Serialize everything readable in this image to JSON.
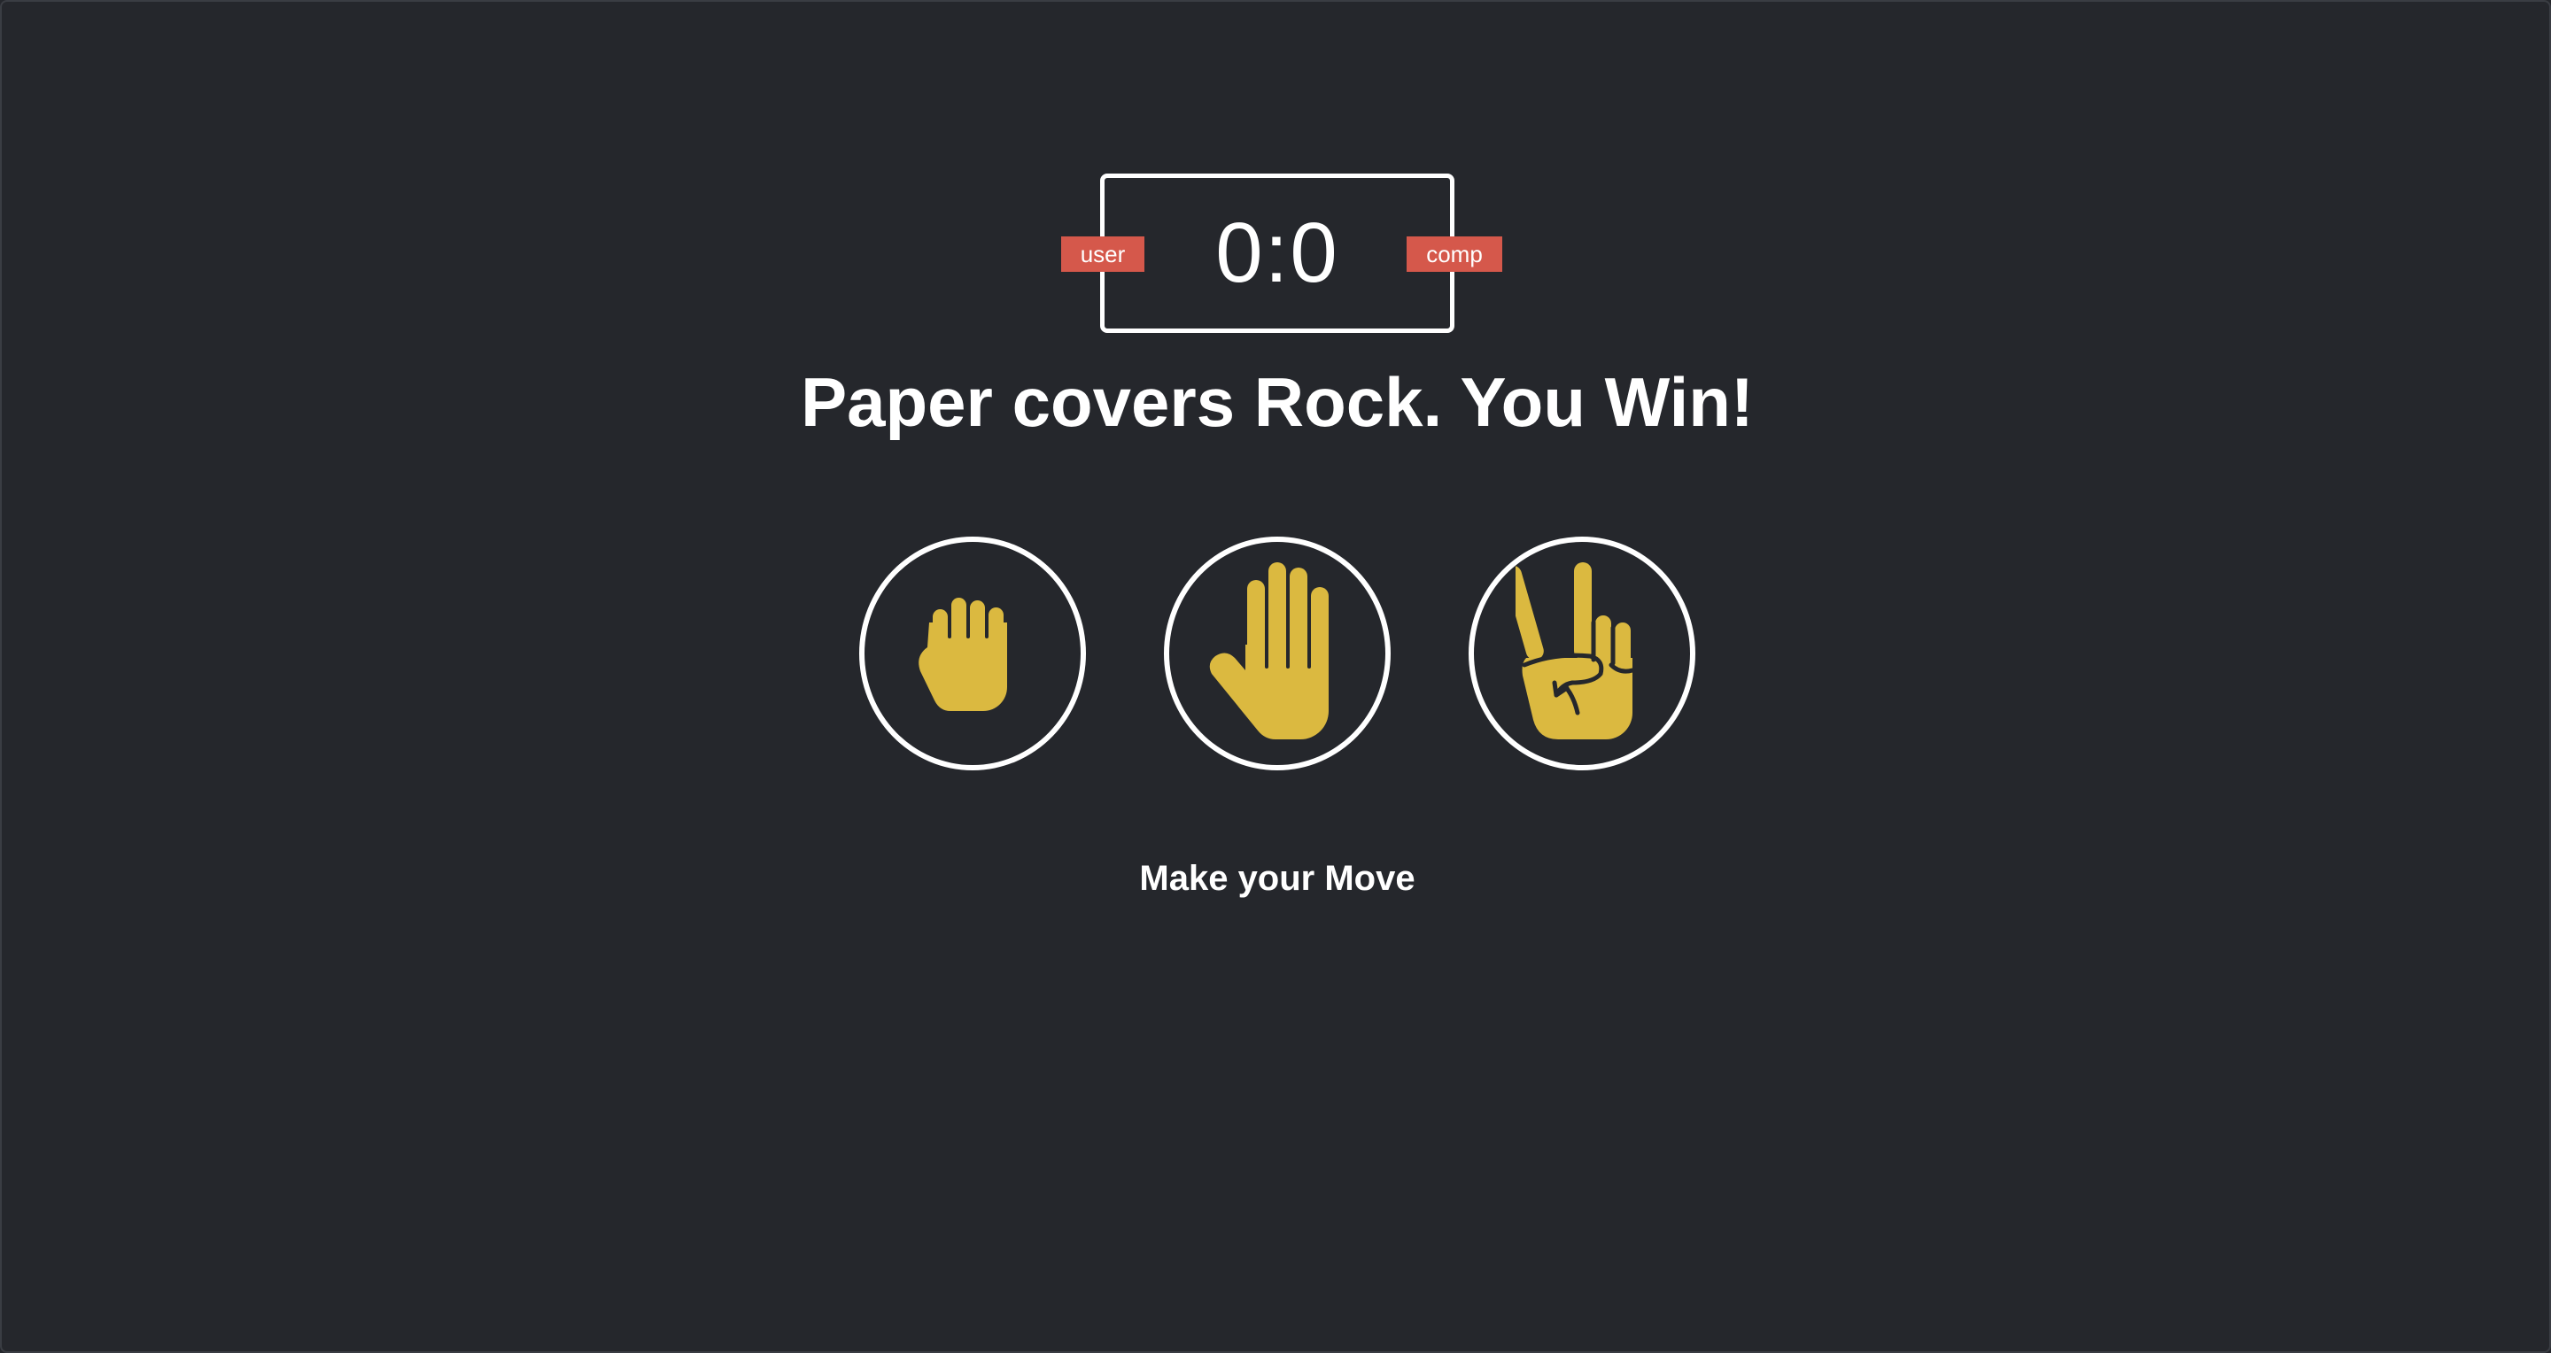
{
  "scoreboard": {
    "score": "0:0",
    "user_label": "user",
    "comp_label": "comp"
  },
  "result": {
    "message": "Paper covers Rock. You Win!"
  },
  "choices": [
    {
      "id": "rock",
      "icon": "fist-icon"
    },
    {
      "id": "paper",
      "icon": "open-hand-icon"
    },
    {
      "id": "scissors",
      "icon": "peace-hand-icon"
    }
  ],
  "prompt": {
    "text": "Make your Move"
  },
  "colors": {
    "background": "#25272c",
    "hand": "#dbb940",
    "badge": "#d5584b",
    "text": "#ffffff"
  }
}
